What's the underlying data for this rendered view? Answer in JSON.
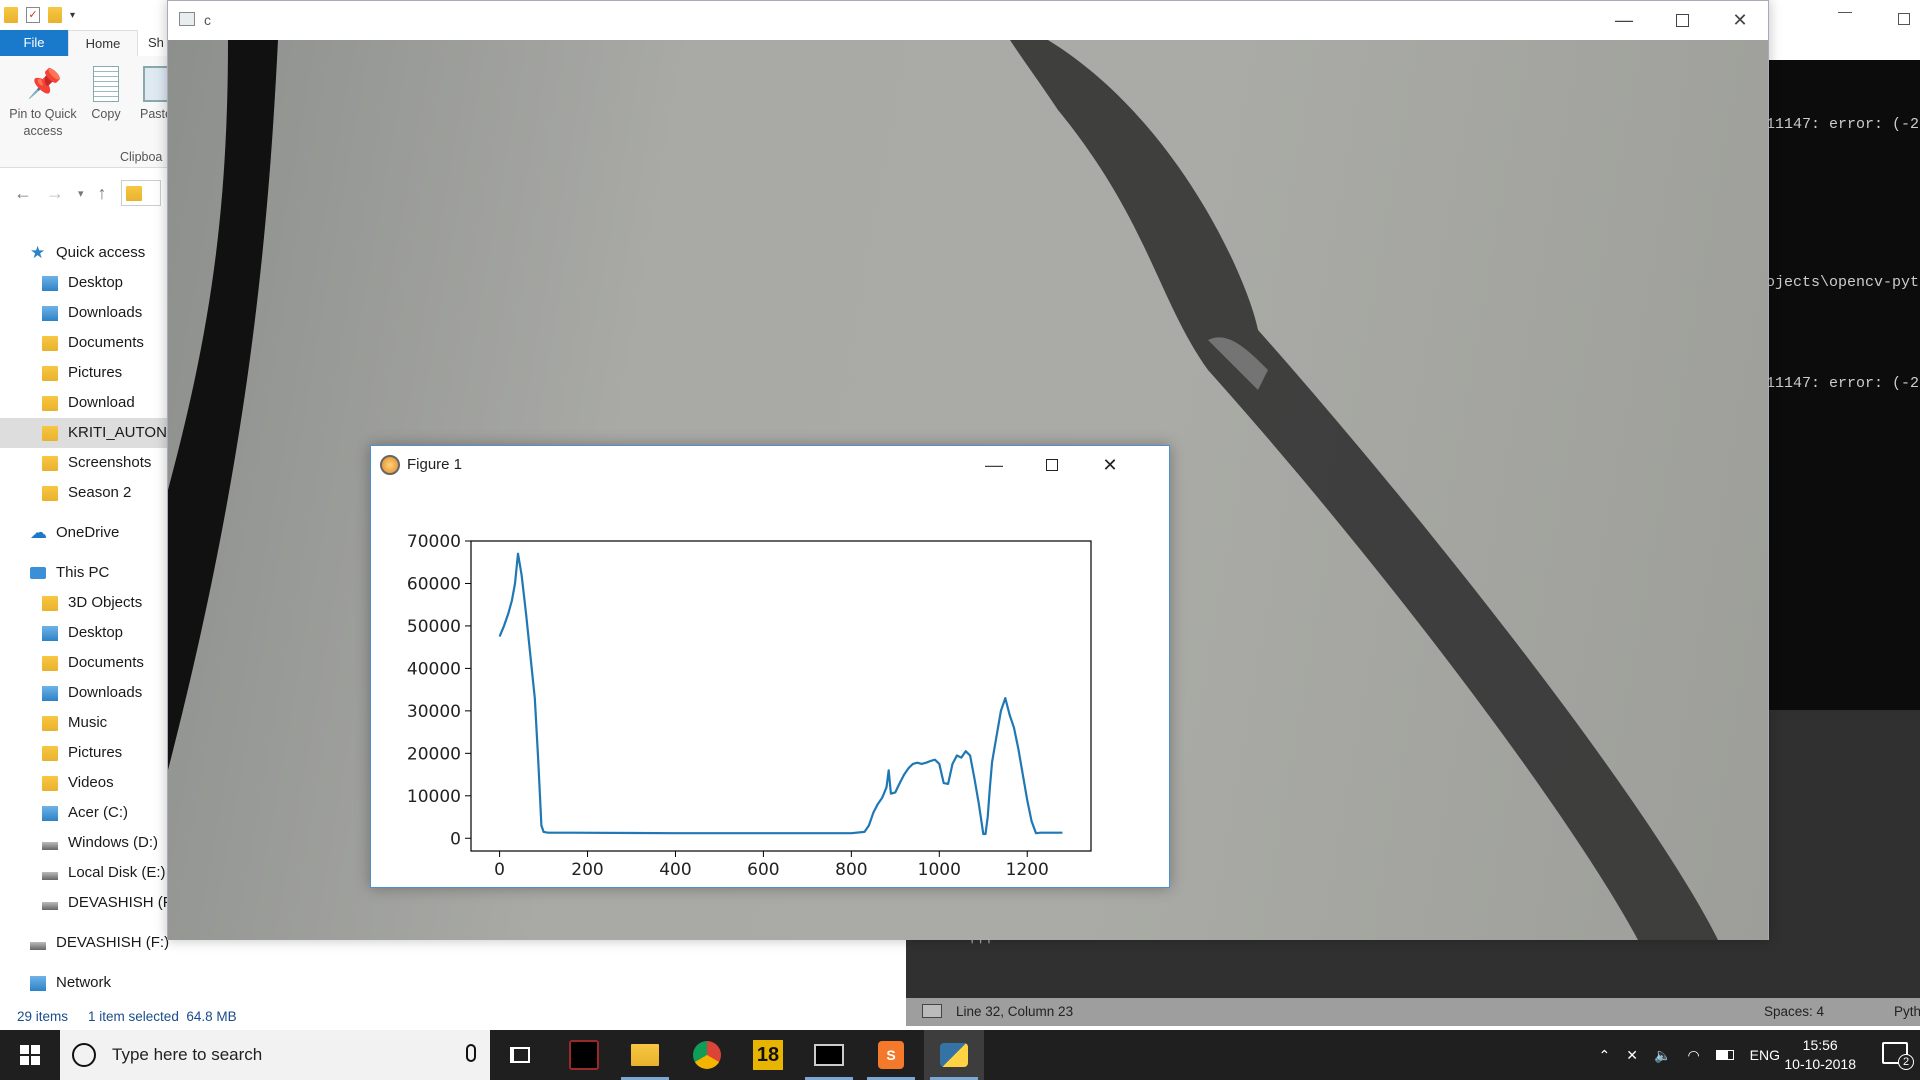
{
  "explorer": {
    "ribbon_tabs": [
      "File",
      "Home",
      "Sh"
    ],
    "ribbon_buttons": {
      "pin": "Pin to Quick\naccess",
      "copy": "Copy",
      "paste": "Paste"
    },
    "ribbon_group": "Clipboa",
    "nav": [
      {
        "label": "Quick access",
        "level": 0,
        "icon": "star-icon"
      },
      {
        "label": "Desktop",
        "level": 1,
        "icon": "folder-blue-icon"
      },
      {
        "label": "Downloads",
        "level": 1,
        "icon": "downloads-icon"
      },
      {
        "label": "Documents",
        "level": 1,
        "icon": "documents-icon"
      },
      {
        "label": "Pictures",
        "level": 1,
        "icon": "pictures-icon"
      },
      {
        "label": "Download",
        "level": 1,
        "icon": "folder-icon"
      },
      {
        "label": "KRITI_AUTONO",
        "level": 1,
        "icon": "folder-icon",
        "selected": true
      },
      {
        "label": "Screenshots",
        "level": 1,
        "icon": "folder-icon"
      },
      {
        "label": "Season 2",
        "level": 1,
        "icon": "folder-icon"
      },
      {
        "label": "OneDrive",
        "level": 0,
        "icon": "cloud-icon"
      },
      {
        "label": "This PC",
        "level": 0,
        "icon": "pc-icon"
      },
      {
        "label": "3D Objects",
        "level": 1,
        "icon": "folder-icon"
      },
      {
        "label": "Desktop",
        "level": 1,
        "icon": "folder-blue-icon"
      },
      {
        "label": "Documents",
        "level": 1,
        "icon": "documents-icon"
      },
      {
        "label": "Downloads",
        "level": 1,
        "icon": "downloads-icon"
      },
      {
        "label": "Music",
        "level": 1,
        "icon": "music-icon"
      },
      {
        "label": "Pictures",
        "level": 1,
        "icon": "pictures-icon"
      },
      {
        "label": "Videos",
        "level": 1,
        "icon": "videos-icon"
      },
      {
        "label": "Acer (C:)",
        "level": 1,
        "icon": "windows-drive-icon"
      },
      {
        "label": "Windows (D:)",
        "level": 1,
        "icon": "drive-icon"
      },
      {
        "label": "Local Disk (E:)",
        "level": 1,
        "icon": "drive-icon"
      },
      {
        "label": "DEVASHISH (F:)",
        "level": 1,
        "icon": "drive-icon"
      },
      {
        "label": "DEVASHISH (F:)",
        "level": 0,
        "icon": "drive-icon"
      },
      {
        "label": "Network",
        "level": 0,
        "icon": "network-icon"
      }
    ],
    "status": {
      "items": "29 items",
      "selection": "1 item selected  64.8 MB"
    }
  },
  "console": {
    "lines": [
      "11147: error: (-2",
      "ojects\\opencv-pyt",
      "11147: error: (-2"
    ]
  },
  "editor": {
    "fragment": "'''",
    "status_position": "Line 32, Column 23",
    "status_spaces": "Spaces: 4",
    "status_syntax": "Pyth"
  },
  "video_window": {
    "title": "c"
  },
  "figure_window": {
    "title": "Figure 1"
  },
  "chart_data": {
    "type": "line",
    "xlim": [
      -65,
      1345
    ],
    "ylim": [
      -3000,
      70000
    ],
    "xticks": [
      0,
      200,
      400,
      600,
      800,
      1000,
      1200
    ],
    "yticks": [
      0,
      10000,
      20000,
      30000,
      40000,
      50000,
      60000,
      70000
    ],
    "xtick_labels": [
      "0",
      "200",
      "400",
      "600",
      "800",
      "1000",
      "1200"
    ],
    "ytick_labels": [
      "0",
      "10000",
      "20000",
      "30000",
      "40000",
      "50000",
      "60000",
      "70000"
    ],
    "color": "#1f77b4",
    "series": [
      {
        "x": [
          0,
          10,
          20,
          28,
          35,
          42,
          50,
          60,
          70,
          80,
          88,
          95,
          100,
          110,
          160,
          400,
          600,
          800,
          830,
          840,
          850,
          860,
          870,
          880,
          885,
          890,
          900,
          910,
          920,
          930,
          940,
          950,
          960,
          970,
          980,
          990,
          1000,
          1010,
          1020,
          1030,
          1040,
          1050,
          1060,
          1070,
          1080,
          1090,
          1100,
          1105,
          1110,
          1115,
          1120,
          1130,
          1140,
          1150,
          1155,
          1160,
          1170,
          1180,
          1190,
          1200,
          1210,
          1220,
          1230,
          1240,
          1260,
          1280
        ],
        "y": [
          47500,
          50000,
          53000,
          56000,
          60000,
          67000,
          62000,
          53000,
          43000,
          33000,
          18000,
          3000,
          1500,
          1300,
          1300,
          1200,
          1200,
          1200,
          1500,
          3000,
          6000,
          8000,
          9500,
          12000,
          16000,
          10500,
          10800,
          13000,
          15000,
          16500,
          17500,
          17800,
          17500,
          17800,
          18200,
          18500,
          17500,
          13000,
          12800,
          17500,
          19500,
          19000,
          20500,
          19500,
          14000,
          8000,
          1000,
          1000,
          5000,
          12000,
          18000,
          24000,
          30000,
          33000,
          31000,
          29000,
          26000,
          21000,
          15000,
          9000,
          4000,
          1200,
          1300,
          1300,
          1300,
          1300
        ]
      }
    ]
  },
  "taskbar": {
    "search_placeholder": "Type here to search",
    "tray_lang": "ENG",
    "clock_time": "15:56",
    "clock_date": "10-10-2018",
    "notification_count": "2",
    "app_badge": "18"
  }
}
